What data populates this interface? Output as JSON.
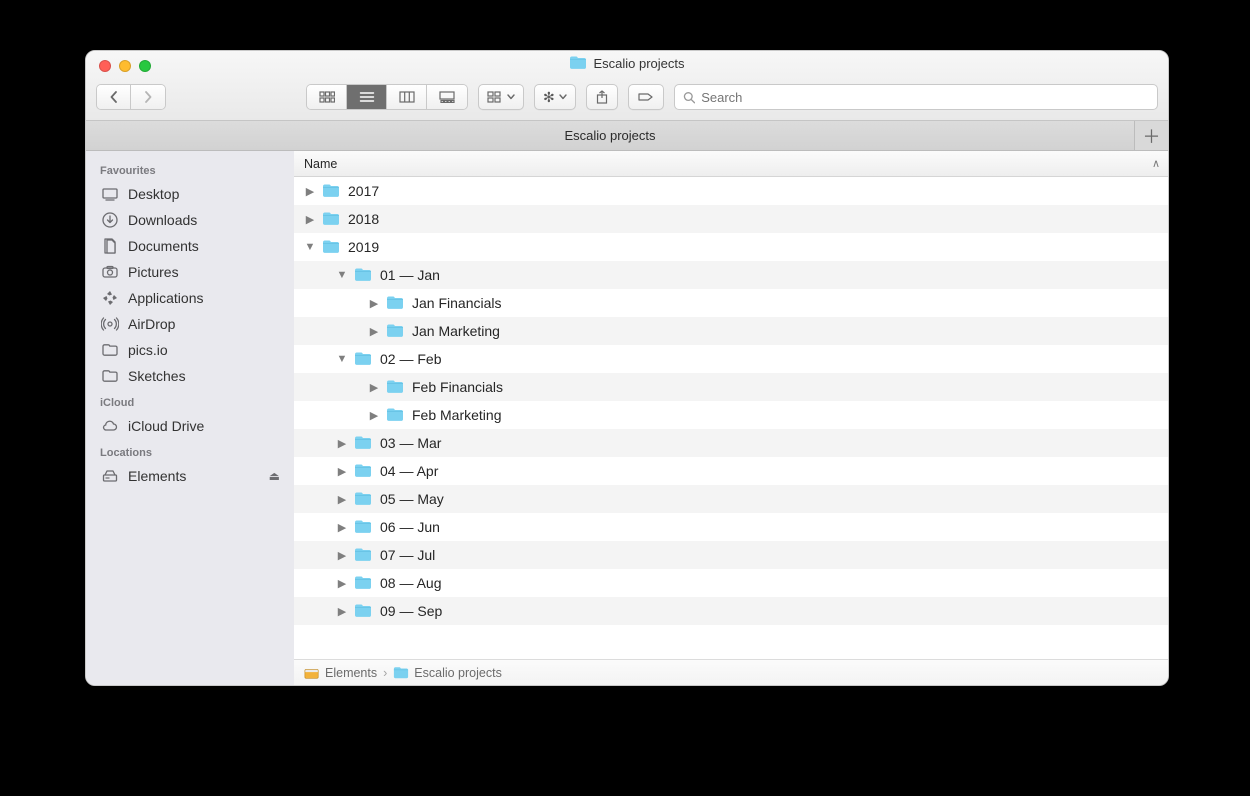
{
  "window": {
    "title": "Escalio projects"
  },
  "tab": {
    "label": "Escalio projects"
  },
  "search": {
    "placeholder": "Search"
  },
  "sidebar": {
    "sections": [
      {
        "heading": "Favourites",
        "items": [
          {
            "icon": "desktop",
            "label": "Desktop"
          },
          {
            "icon": "download",
            "label": "Downloads"
          },
          {
            "icon": "document",
            "label": "Documents"
          },
          {
            "icon": "camera",
            "label": "Pictures"
          },
          {
            "icon": "apps",
            "label": "Applications"
          },
          {
            "icon": "broadcast",
            "label": "AirDrop"
          },
          {
            "icon": "folder",
            "label": "pics.io"
          },
          {
            "icon": "folder",
            "label": "Sketches"
          }
        ]
      },
      {
        "heading": "iCloud",
        "items": [
          {
            "icon": "cloud",
            "label": "iCloud Drive"
          }
        ]
      },
      {
        "heading": "Locations",
        "items": [
          {
            "icon": "drive",
            "label": "Elements",
            "eject": true
          }
        ]
      }
    ]
  },
  "header": {
    "name_col": "Name"
  },
  "files": [
    {
      "indent": 0,
      "open": false,
      "label": "2017"
    },
    {
      "indent": 0,
      "open": false,
      "label": "2018"
    },
    {
      "indent": 0,
      "open": true,
      "label": "2019"
    },
    {
      "indent": 1,
      "open": true,
      "label": "01 — Jan"
    },
    {
      "indent": 2,
      "open": false,
      "label": "Jan Financials"
    },
    {
      "indent": 2,
      "open": false,
      "label": "Jan Marketing"
    },
    {
      "indent": 1,
      "open": true,
      "label": "02 — Feb"
    },
    {
      "indent": 2,
      "open": false,
      "label": "Feb Financials"
    },
    {
      "indent": 2,
      "open": false,
      "label": "Feb Marketing"
    },
    {
      "indent": 1,
      "open": false,
      "label": "03 — Mar"
    },
    {
      "indent": 1,
      "open": false,
      "label": "04 — Apr"
    },
    {
      "indent": 1,
      "open": false,
      "label": "05 — May"
    },
    {
      "indent": 1,
      "open": false,
      "label": "06 — Jun"
    },
    {
      "indent": 1,
      "open": false,
      "label": "07 — Jul"
    },
    {
      "indent": 1,
      "open": false,
      "label": "08 — Aug"
    },
    {
      "indent": 1,
      "open": false,
      "label": "09 — Sep"
    }
  ],
  "path": {
    "segments": [
      {
        "icon": "drive-orange",
        "label": "Elements"
      },
      {
        "icon": "folder",
        "label": "Escalio projects"
      }
    ]
  }
}
